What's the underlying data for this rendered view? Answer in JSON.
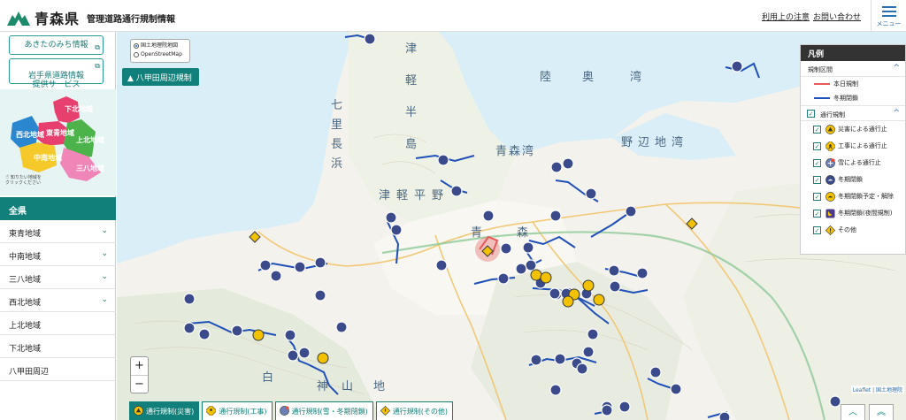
{
  "header": {
    "title": "青森県",
    "subtitle": "管理道路通行規制情報",
    "links": [
      "利用上の注意",
      "お問い合わせ"
    ],
    "menu_label": "メニュー"
  },
  "sidebar": {
    "ext_links": [
      {
        "label": "あきたのみち情報"
      },
      {
        "label": "岩手県道路情報\n提供サービス"
      }
    ],
    "region_map_labels": [
      "下北地域",
      "西北地域",
      "東青地域",
      "上北地域",
      "中南地域",
      "三八地域"
    ],
    "region_hint": "知りたい地域を\nクリックください",
    "all_label": "全県",
    "regions": [
      {
        "label": "東青地域",
        "chevron": true
      },
      {
        "label": "中南地域",
        "chevron": true
      },
      {
        "label": "三八地域",
        "chevron": true
      },
      {
        "label": "西北地域",
        "chevron": true
      },
      {
        "label": "上北地域",
        "chevron": false
      },
      {
        "label": "下北地域",
        "chevron": false
      },
      {
        "label": "八甲田周辺",
        "chevron": false
      }
    ]
  },
  "map": {
    "tile_options": [
      {
        "label": "国土地理院地図",
        "selected": true
      },
      {
        "label": "OpenStreetMap",
        "selected": false
      }
    ],
    "hakkoda_button": "八甲田周辺規制",
    "zoom_in": "+",
    "zoom_out": "−",
    "attribution": "Leaflet | 国土地理院",
    "place_labels": [
      {
        "text": "津"
      },
      {
        "text": "軽"
      },
      {
        "text": "半"
      },
      {
        "text": "島"
      },
      {
        "text": "七"
      },
      {
        "text": "里"
      },
      {
        "text": "長"
      },
      {
        "text": "浜"
      },
      {
        "text": "陸"
      },
      {
        "text": "奥"
      },
      {
        "text": "湾"
      },
      {
        "text": "青森湾"
      },
      {
        "text": "野辺地湾"
      },
      {
        "text": "津軽平野"
      },
      {
        "text": "青"
      },
      {
        "text": "森"
      },
      {
        "text": "白"
      },
      {
        "text": "神"
      },
      {
        "text": "山"
      },
      {
        "text": "地"
      }
    ]
  },
  "legend": {
    "title": "凡例",
    "section_kisei": "規制区間",
    "lines": [
      {
        "label": "本日規制",
        "color": "#e85a5a"
      },
      {
        "label": "冬期閉鎖",
        "color": "#1f4fb8"
      }
    ],
    "section_tsuko": "通行規制",
    "items": [
      {
        "label": "災害による通行止",
        "icon": "disaster-icon",
        "checked": true
      },
      {
        "label": "工事による通行止",
        "icon": "construction-icon",
        "checked": true
      },
      {
        "label": "雪による通行止",
        "icon": "snow-icon",
        "checked": true
      },
      {
        "label": "冬期閉鎖",
        "icon": "winter-closure-icon",
        "checked": true
      },
      {
        "label": "冬期閉鎖予定・解除",
        "icon": "winter-schedule-icon",
        "checked": true
      },
      {
        "label": "冬期閉鎖(夜間規制)",
        "icon": "night-closure-icon",
        "checked": true
      },
      {
        "label": "その他",
        "icon": "other-icon",
        "checked": true
      }
    ]
  },
  "bottom_tabs": [
    {
      "label": "通行規制(災害)",
      "icon": "disaster-icon",
      "active": true
    },
    {
      "label": "通行規制(工事)",
      "icon": "construction-icon",
      "active": false
    },
    {
      "label": "通行規制(雪・冬期閉鎖)",
      "icon": "snow-icon",
      "active": false
    },
    {
      "label": "通行規制(その他)",
      "icon": "other-icon",
      "active": false
    }
  ],
  "colors": {
    "accent": "#11807a",
    "closure_line": "#1f4fb8",
    "today_line": "#e85a5a",
    "marker_navy": "#3a4a8a",
    "marker_yellow": "#f2c200"
  }
}
